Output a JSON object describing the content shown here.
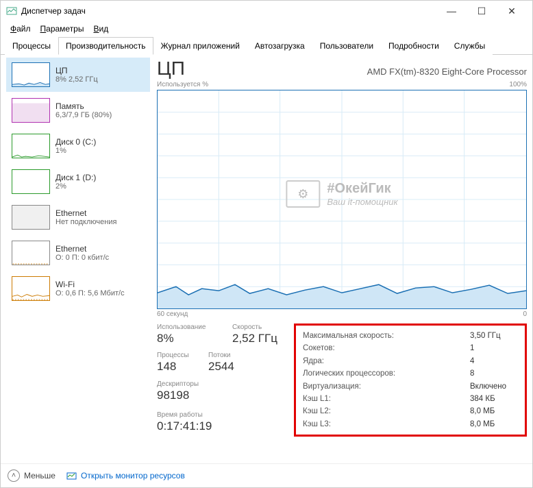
{
  "window": {
    "title": "Диспетчер задач"
  },
  "menu": {
    "file": "Файл",
    "options": "Параметры",
    "view": "Вид",
    "file_u": "Ф",
    "options_u": "П",
    "view_u": "В"
  },
  "tabs": {
    "processes": "Процессы",
    "performance": "Производительность",
    "apphistory": "Журнал приложений",
    "startup": "Автозагрузка",
    "users": "Пользователи",
    "details": "Подробности",
    "services": "Службы"
  },
  "sidebar": [
    {
      "title": "ЦП",
      "sub": "8% 2,52 ГГц",
      "kind": "cpu"
    },
    {
      "title": "Память",
      "sub": "6,3/7,9 ГБ (80%)",
      "kind": "mem"
    },
    {
      "title": "Диск 0 (C:)",
      "sub": "1%",
      "kind": "disk"
    },
    {
      "title": "Диск 1 (D:)",
      "sub": "2%",
      "kind": "disk"
    },
    {
      "title": "Ethernet",
      "sub": "Нет подключения",
      "kind": "eth"
    },
    {
      "title": "Ethernet",
      "sub": "О: 0 П: 0 кбит/с",
      "kind": "eth2"
    },
    {
      "title": "Wi-Fi",
      "sub": "О: 0,6 П: 5,6 Мбит/с",
      "kind": "wifi"
    }
  ],
  "main": {
    "title": "ЦП",
    "cpu_name": "AMD FX(tm)-8320 Eight-Core Processor",
    "y_label": "Используется %",
    "y_max": "100%",
    "x_left": "60 секунд",
    "x_right": "0",
    "watermark1": "#ОкейГик",
    "watermark2": "Ваш it-помощник"
  },
  "stats": {
    "usage_l": "Использование",
    "usage_v": "8%",
    "speed_l": "Скорость",
    "speed_v": "2,52 ГГц",
    "procs_l": "Процессы",
    "procs_v": "148",
    "threads_l": "Потоки",
    "threads_v": "2544",
    "handles_l": "Дескрипторы",
    "handles_v": "98198",
    "uptime_l": "Время работы",
    "uptime_v": "0:17:41:19"
  },
  "specs": {
    "maxspeed_l": "Максимальная скорость:",
    "maxspeed_v": "3,50 ГГц",
    "sockets_l": "Сокетов:",
    "sockets_v": "1",
    "cores_l": "Ядра:",
    "cores_v": "4",
    "lprocs_l": "Логических процессоров:",
    "lprocs_v": "8",
    "virt_l": "Виртуализация:",
    "virt_v": "Включено",
    "l1_l": "Кэш L1:",
    "l1_v": "384 КБ",
    "l2_l": "Кэш L2:",
    "l2_v": "8,0 МБ",
    "l3_l": "Кэш L3:",
    "l3_v": "8,0 МБ"
  },
  "bottom": {
    "less": "Меньше",
    "resmon": "Открыть монитор ресурсов"
  },
  "chart_data": {
    "type": "line",
    "title": "Используется %",
    "xlabel": "60 секунд → 0",
    "ylabel": "%",
    "ylim": [
      0,
      100
    ],
    "x": [
      0,
      5,
      10,
      15,
      20,
      25,
      30,
      35,
      40,
      45,
      50,
      55,
      60
    ],
    "values": [
      7,
      10,
      6,
      9,
      8,
      11,
      7,
      9,
      6,
      8,
      10,
      7,
      8
    ]
  }
}
